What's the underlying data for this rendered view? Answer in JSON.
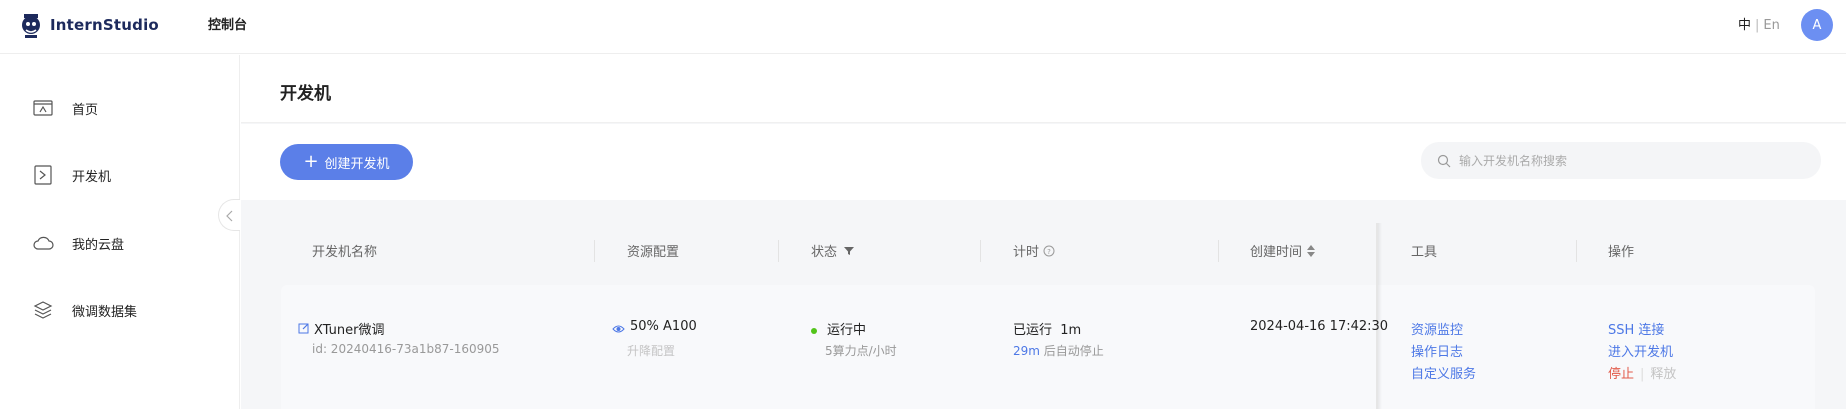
{
  "header": {
    "logo_text": "InternStudio",
    "console_label": "控制台",
    "lang_zh": "中",
    "lang_sep": "|",
    "lang_en": "En",
    "avatar_letter": "A"
  },
  "sidebar": {
    "items": [
      {
        "label": "首页",
        "icon": "home-icon"
      },
      {
        "label": "开发机",
        "icon": "terminal-icon"
      },
      {
        "label": "我的云盘",
        "icon": "cloud-icon"
      },
      {
        "label": "微调数据集",
        "icon": "layers-icon"
      }
    ]
  },
  "main": {
    "page_title": "开发机",
    "create_button": "创建开发机",
    "search_placeholder": "输入开发机名称搜索"
  },
  "table": {
    "columns": [
      "开发机名称",
      "资源配置",
      "状态",
      "计时",
      "创建时间",
      "工具",
      "操作"
    ],
    "rows": [
      {
        "name": "XTuner微调",
        "id": "id: 20240416-73a1b87-160905",
        "resource": "50% A100",
        "resource_action": "升降配置",
        "status": "运行中",
        "status_color": "#52c41a",
        "status_detail": "5算力点/小时",
        "runtime_prefix": "已运行",
        "runtime_value": "1m",
        "auto_stop_value": "29m",
        "auto_stop_suffix": "后自动停止",
        "created": "2024-04-16 17:42:30",
        "tools": [
          "资源监控",
          "操作日志",
          "自定义服务"
        ],
        "ops_ssh": "SSH 连接",
        "ops_enter": "进入开发机",
        "ops_stop": "停止",
        "ops_sep": "|",
        "ops_release": "释放"
      }
    ]
  },
  "colors": {
    "accent": "#5b7fe8",
    "link": "#4d78e6",
    "danger": "#e25b4b"
  }
}
